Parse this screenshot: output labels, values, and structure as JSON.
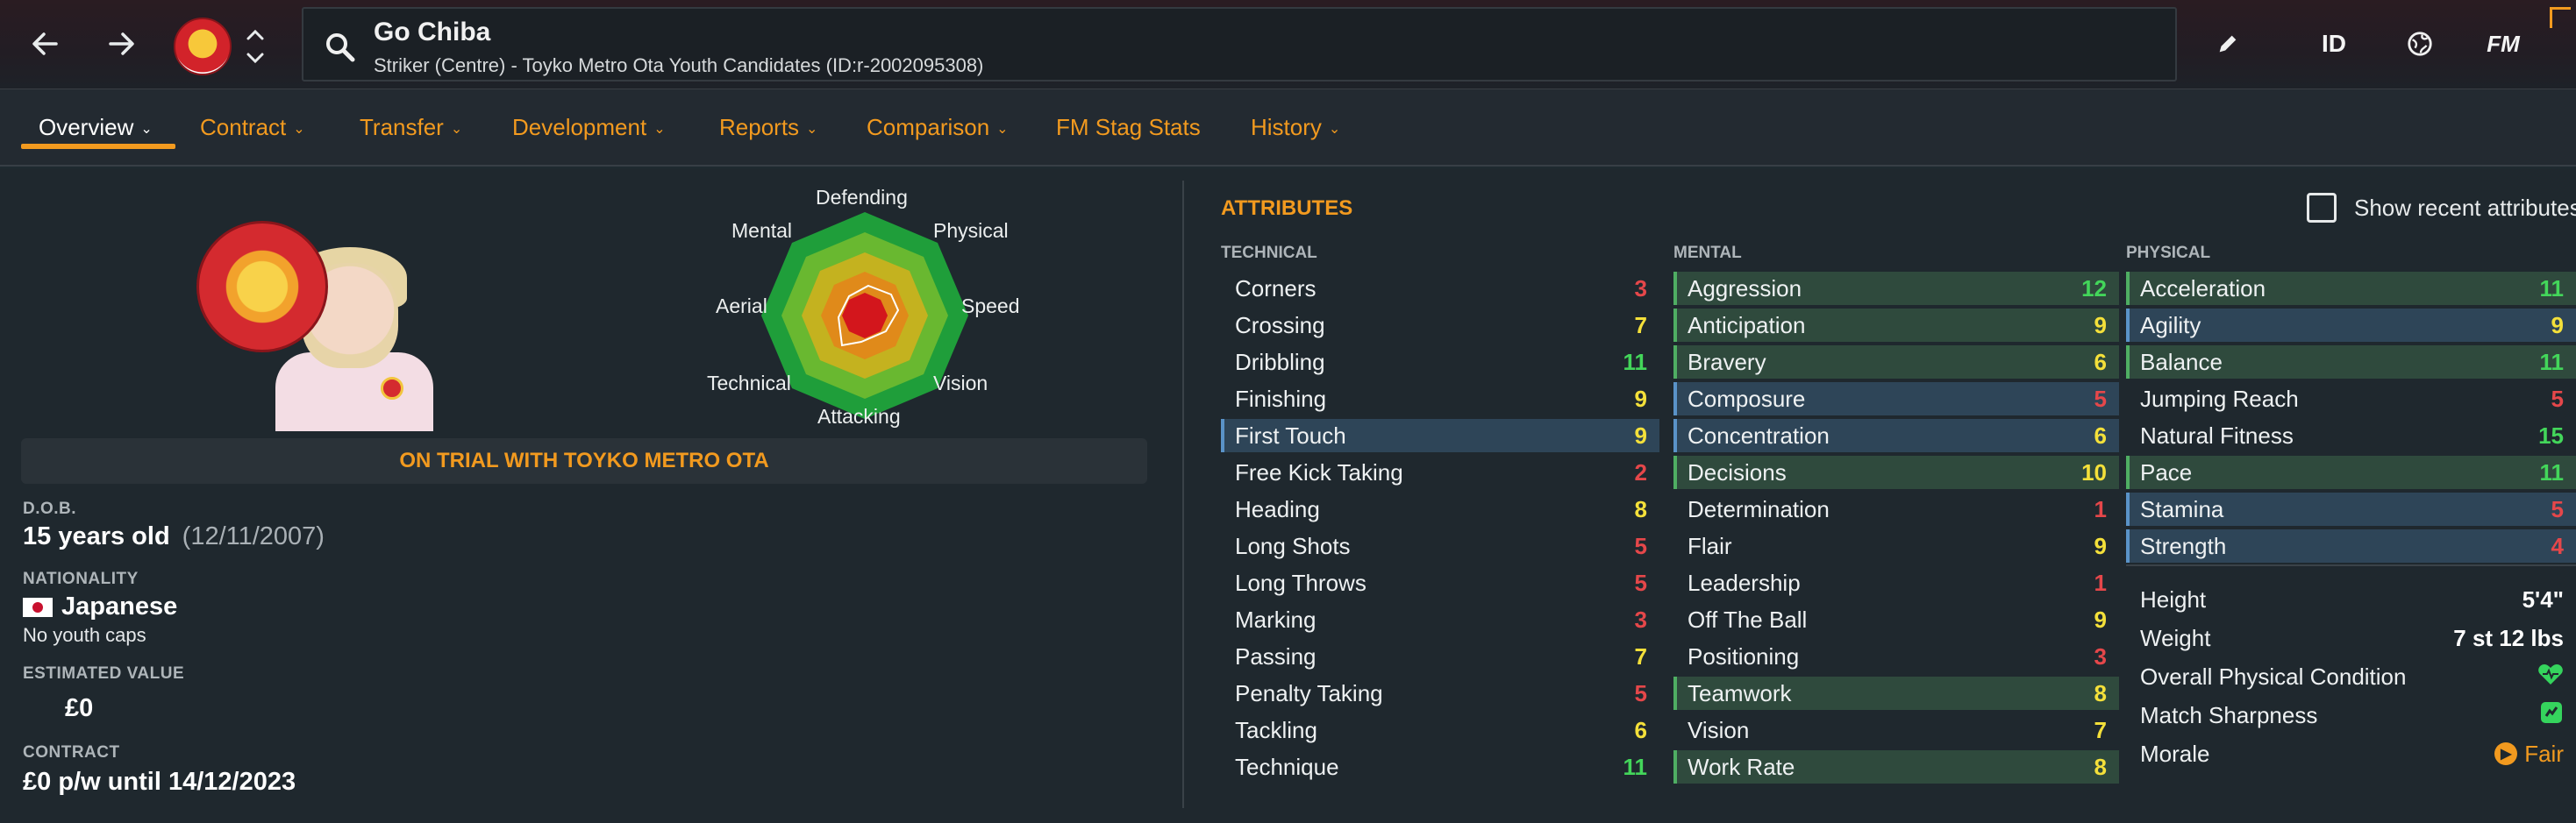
{
  "header": {
    "player_name": "Go Chiba",
    "player_subtitle": "Striker (Centre) - Toyko Metro Ota Youth Candidates (ID:r-2002095308)",
    "tools": {
      "id_label": "ID",
      "fm_label": "FM"
    }
  },
  "tabs": [
    {
      "label": "Overview",
      "has_menu": true,
      "active": true
    },
    {
      "label": "Contract",
      "has_menu": true
    },
    {
      "label": "Transfer",
      "has_menu": true
    },
    {
      "label": "Development",
      "has_menu": true
    },
    {
      "label": "Reports",
      "has_menu": true
    },
    {
      "label": "Comparison",
      "has_menu": true
    },
    {
      "label": "FM Stag Stats",
      "has_menu": false
    },
    {
      "label": "History",
      "has_menu": true
    }
  ],
  "radar": {
    "labels": {
      "defending": "Defending",
      "physical": "Physical",
      "speed": "Speed",
      "vision": "Vision",
      "attacking": "Attacking",
      "technical": "Technical",
      "aerial": "Aerial",
      "mental": "Mental"
    }
  },
  "status": {
    "trial": "ON TRIAL WITH TOYKO METRO OTA"
  },
  "info": {
    "dob_label": "D.O.B.",
    "age": "15 years old",
    "dob": "(12/11/2007)",
    "nationality_label": "NATIONALITY",
    "nationality": "Japanese",
    "caps": "No youth caps",
    "value_label": "ESTIMATED VALUE",
    "value": "£0",
    "contract_label": "CONTRACT",
    "contract": "£0 p/w until 14/12/2023"
  },
  "attributes": {
    "title": "ATTRIBUTES",
    "show_recent_label": "Show recent attributes",
    "columns": {
      "technical": "TECHNICAL",
      "mental": "MENTAL",
      "physical": "PHYSICAL"
    },
    "technical": [
      {
        "name": "Corners",
        "value": "3",
        "hl": ""
      },
      {
        "name": "Crossing",
        "value": "7",
        "hl": ""
      },
      {
        "name": "Dribbling",
        "value": "11",
        "hl": ""
      },
      {
        "name": "Finishing",
        "value": "9",
        "hl": ""
      },
      {
        "name": "First Touch",
        "value": "9",
        "hl": "blue"
      },
      {
        "name": "Free Kick Taking",
        "value": "2",
        "hl": ""
      },
      {
        "name": "Heading",
        "value": "8",
        "hl": ""
      },
      {
        "name": "Long Shots",
        "value": "5",
        "hl": ""
      },
      {
        "name": "Long Throws",
        "value": "5",
        "hl": ""
      },
      {
        "name": "Marking",
        "value": "3",
        "hl": ""
      },
      {
        "name": "Passing",
        "value": "7",
        "hl": ""
      },
      {
        "name": "Penalty Taking",
        "value": "5",
        "hl": ""
      },
      {
        "name": "Tackling",
        "value": "6",
        "hl": ""
      },
      {
        "name": "Technique",
        "value": "11",
        "hl": ""
      }
    ],
    "mental": [
      {
        "name": "Aggression",
        "value": "12",
        "hl": "green"
      },
      {
        "name": "Anticipation",
        "value": "9",
        "hl": "green"
      },
      {
        "name": "Bravery",
        "value": "6",
        "hl": "green"
      },
      {
        "name": "Composure",
        "value": "5",
        "hl": "blue"
      },
      {
        "name": "Concentration",
        "value": "6",
        "hl": "blue"
      },
      {
        "name": "Decisions",
        "value": "10",
        "hl": "green"
      },
      {
        "name": "Determination",
        "value": "1",
        "hl": ""
      },
      {
        "name": "Flair",
        "value": "9",
        "hl": ""
      },
      {
        "name": "Leadership",
        "value": "1",
        "hl": ""
      },
      {
        "name": "Off The Ball",
        "value": "9",
        "hl": ""
      },
      {
        "name": "Positioning",
        "value": "3",
        "hl": ""
      },
      {
        "name": "Teamwork",
        "value": "8",
        "hl": "green"
      },
      {
        "name": "Vision",
        "value": "7",
        "hl": ""
      },
      {
        "name": "Work Rate",
        "value": "8",
        "hl": "green"
      }
    ],
    "physical": [
      {
        "name": "Acceleration",
        "value": "11",
        "hl": "green"
      },
      {
        "name": "Agility",
        "value": "9",
        "hl": "blue"
      },
      {
        "name": "Balance",
        "value": "11",
        "hl": "green"
      },
      {
        "name": "Jumping Reach",
        "value": "5",
        "hl": ""
      },
      {
        "name": "Natural Fitness",
        "value": "15",
        "hl": ""
      },
      {
        "name": "Pace",
        "value": "11",
        "hl": "green"
      },
      {
        "name": "Stamina",
        "value": "5",
        "hl": "blue"
      },
      {
        "name": "Strength",
        "value": "4",
        "hl": "blue"
      }
    ],
    "physical_info": [
      {
        "name": "Height",
        "value": "5'4\""
      },
      {
        "name": "Weight",
        "value": "7 st 12 lbs"
      },
      {
        "name": "Overall Physical Condition",
        "value": "",
        "icon": "heart-icon"
      },
      {
        "name": "Match Sharpness",
        "value": "",
        "icon": "sharpness-icon"
      },
      {
        "name": "Morale",
        "value": "Fair",
        "icon": "morale-icon"
      }
    ]
  },
  "colors": {
    "accent": "#f29a1f",
    "value_low": "#e5474a",
    "value_mid": "#f4e03a",
    "value_high": "#43d65a"
  }
}
